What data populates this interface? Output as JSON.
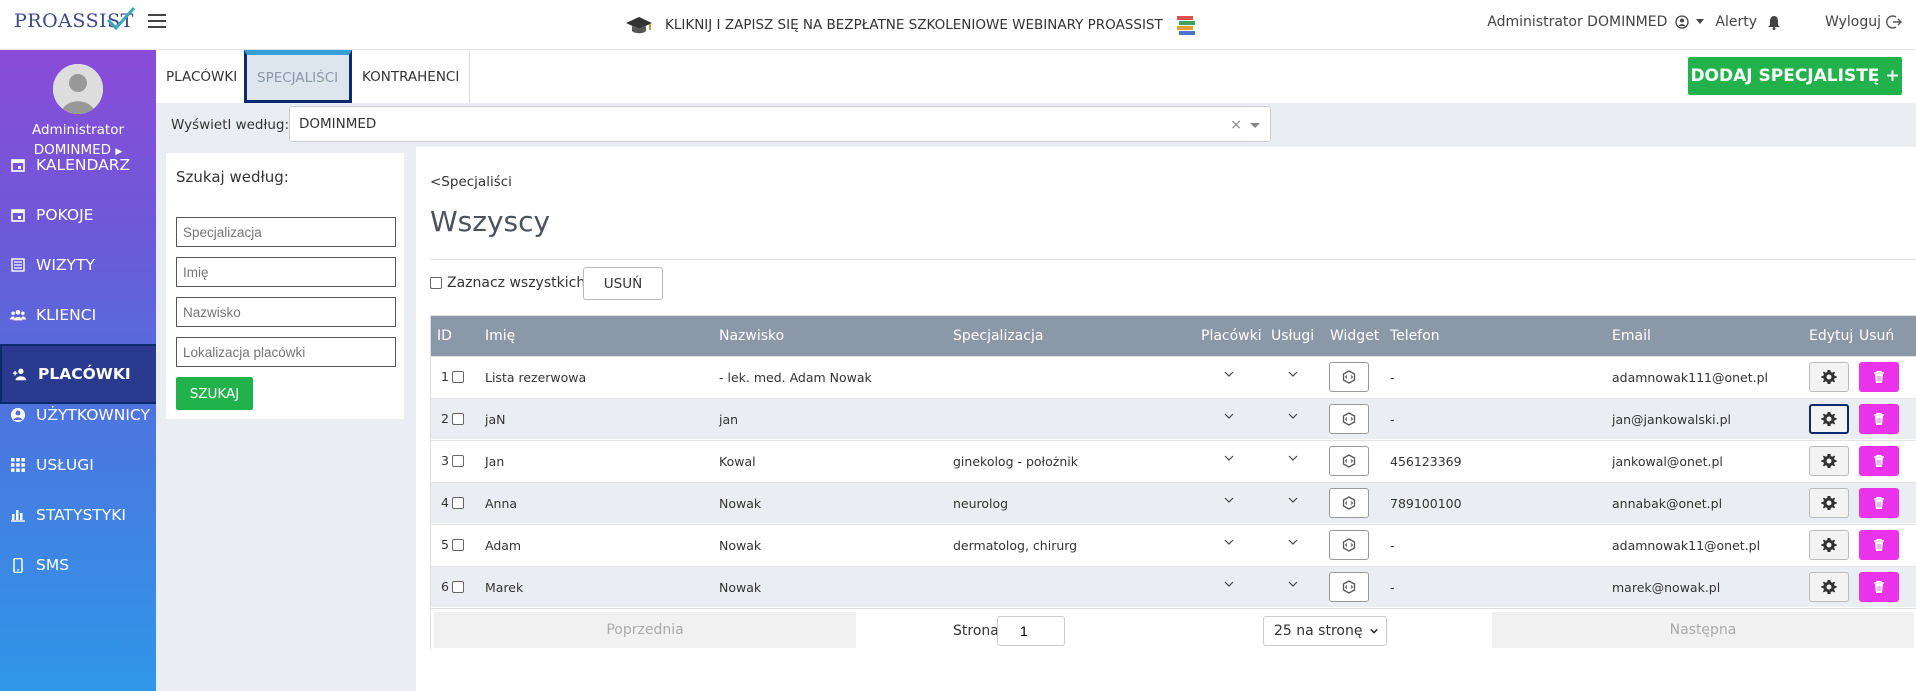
{
  "topbar": {
    "logo_text": "PROASSIST",
    "banner_text": "KLIKNIJ I ZAPISZ SIĘ NA BEZPŁATNE SZKOLENIOWE WEBINARY PROASSIST",
    "user_label": "Administrator DOMINMED",
    "alerts_label": "Alerty",
    "logout_label": "Wyloguj"
  },
  "sidebar": {
    "user_line1": "Administrator",
    "user_line2": "DOMINMED",
    "items": [
      {
        "label": "KALENDARZ",
        "icon": "calendar-icon"
      },
      {
        "label": "POKOJE",
        "icon": "calendar-icon"
      },
      {
        "label": "WIZYTY",
        "icon": "list-icon"
      },
      {
        "label": "KLIENCI",
        "icon": "users-icon"
      },
      {
        "label": "PLACÓWKI",
        "icon": "user-plus-icon"
      },
      {
        "label": "UŻYTKOWNICY",
        "icon": "user-circle-icon"
      },
      {
        "label": "USŁUGI",
        "icon": "grid-icon"
      },
      {
        "label": "STATYSTYKI",
        "icon": "bar-chart-icon"
      },
      {
        "label": "SMS",
        "icon": "mobile-icon"
      }
    ],
    "active_index": 4
  },
  "subtabs": [
    "PLACÓWKI",
    "SPECJALIŚCI",
    "KONTRAHENCI"
  ],
  "add_button": "DODAJ SPECJALISTĘ +",
  "filter": {
    "label": "Wyświetl według:",
    "value": "DOMINMED",
    "clear": "×"
  },
  "search": {
    "title": "Szukaj według:",
    "placeholders": [
      "Specjalizacja",
      "Imię",
      "Nazwisko",
      "Lokalizacja placówki"
    ],
    "button": "SZUKAJ"
  },
  "main": {
    "breadcrumb": "<Specjaliści",
    "title": "Wszyscy",
    "select_all": "Zaznacz wszystkich",
    "delete_button": "USUŃ"
  },
  "table": {
    "headers": [
      "ID",
      "Imię",
      "Nazwisko",
      "Specjalizacja",
      "Placówki",
      "Usługi",
      "Widget",
      "Telefon",
      "Email",
      "Edytuj",
      "Usuń"
    ],
    "rows": [
      {
        "id": "1",
        "first": "Lista rezerwowa",
        "last": "- lek. med. Adam Nowak",
        "spec": "",
        "phone": "-",
        "email": "adamnowak111@onet.pl"
      },
      {
        "id": "2",
        "first": "jaN",
        "last": "jan",
        "spec": "",
        "phone": "-",
        "email": "jan@jankowalski.pl"
      },
      {
        "id": "3",
        "first": "Jan",
        "last": "Kowal",
        "spec": "ginekolog - położnik",
        "phone": "456123369",
        "email": "jankowal@onet.pl"
      },
      {
        "id": "4",
        "first": "Anna",
        "last": "Nowak",
        "spec": "neurolog",
        "phone": "789100100",
        "email": "annabak@onet.pl"
      },
      {
        "id": "5",
        "first": "Adam",
        "last": "Nowak",
        "spec": "dermatolog, chirurg",
        "phone": "-",
        "email": "adamnowak11@onet.pl"
      },
      {
        "id": "6",
        "first": "Marek",
        "last": "Nowak",
        "spec": "",
        "phone": "-",
        "email": "marek@nowak.pl"
      }
    ]
  },
  "pager": {
    "prev": "Poprzednia",
    "page_label": "Strona",
    "page_value": "1",
    "per_page": "25 na stronę",
    "next": "Następna"
  },
  "colors": {
    "green": "#22b24c",
    "magenta": "#ea33ea",
    "header_gray": "#8a98a8",
    "active_nav": "#2a3b8f"
  }
}
